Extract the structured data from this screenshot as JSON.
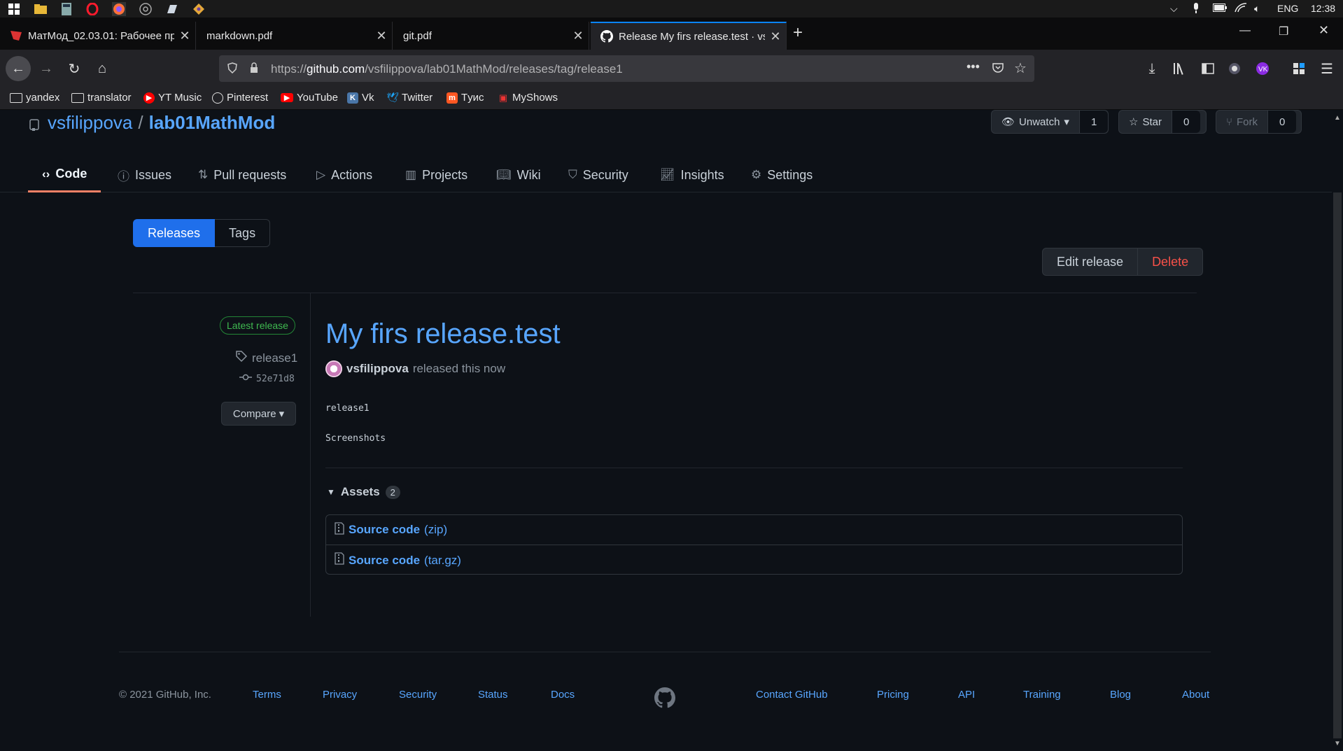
{
  "taskbar": {
    "tray": {
      "lang": "ENG",
      "time": "12:38"
    }
  },
  "browser": {
    "tabs": [
      {
        "title": "МатМод_02.03.01: Рабочее пр",
        "active": false
      },
      {
        "title": "markdown.pdf",
        "active": false
      },
      {
        "title": "git.pdf",
        "active": false
      },
      {
        "title": "Release My firs release.test · vsf",
        "active": true
      }
    ],
    "url": {
      "prefix": "https://",
      "domain": "github.com",
      "path": "/vsfilippova/lab01MathMod/releases/tag/release1"
    },
    "bookmarks": [
      "yandex",
      "translator",
      "YT Music",
      "Pinterest",
      "YouTube",
      "Vk",
      "Twitter",
      "Тyис",
      "MyShows"
    ]
  },
  "repo": {
    "owner": "vsfilippova",
    "separator": "/",
    "name": "lab01MathMod",
    "unwatch_label": "Unwatch",
    "unwatch_count": "1",
    "star_label": "Star",
    "star_count": "0",
    "fork_label": "Fork",
    "fork_count": "0"
  },
  "repo_nav": [
    {
      "label": "Code",
      "icon": "code-icon",
      "active": true
    },
    {
      "label": "Issues",
      "icon": "issue-icon",
      "active": false
    },
    {
      "label": "Pull requests",
      "icon": "pull-request-icon",
      "active": false
    },
    {
      "label": "Actions",
      "icon": "play-icon",
      "active": false
    },
    {
      "label": "Projects",
      "icon": "project-icon",
      "active": false
    },
    {
      "label": "Wiki",
      "icon": "book-icon",
      "active": false
    },
    {
      "label": "Security",
      "icon": "shield-icon",
      "active": false
    },
    {
      "label": "Insights",
      "icon": "graph-icon",
      "active": false
    },
    {
      "label": "Settings",
      "icon": "gear-icon",
      "active": false
    }
  ],
  "subnav": {
    "releases": "Releases",
    "tags": "Tags"
  },
  "actions": {
    "edit": "Edit release",
    "delete": "Delete"
  },
  "release": {
    "badge": "Latest release",
    "tag": "release1",
    "commit": "52e71d8",
    "compare": "Compare",
    "title": "My firs release.test",
    "author": "vsfilippova",
    "released_text": "released this now",
    "body": [
      "release1",
      "Screenshots"
    ],
    "assets_label": "Assets",
    "assets_count": "2",
    "assets": [
      {
        "name": "Source code",
        "ext": "(zip)"
      },
      {
        "name": "Source code",
        "ext": "(tar.gz)"
      }
    ]
  },
  "footer": {
    "copyright": "© 2021 GitHub, Inc.",
    "left_links": [
      "Terms",
      "Privacy",
      "Security",
      "Status",
      "Docs"
    ],
    "right_links": [
      "Contact GitHub",
      "Pricing",
      "API",
      "Training",
      "Blog",
      "About"
    ]
  },
  "colors": {
    "link": "#58a6ff",
    "accent_blue": "#1f6feb",
    "danger": "#f85149",
    "success": "#3fb950",
    "tab_underline": "#f78166"
  }
}
